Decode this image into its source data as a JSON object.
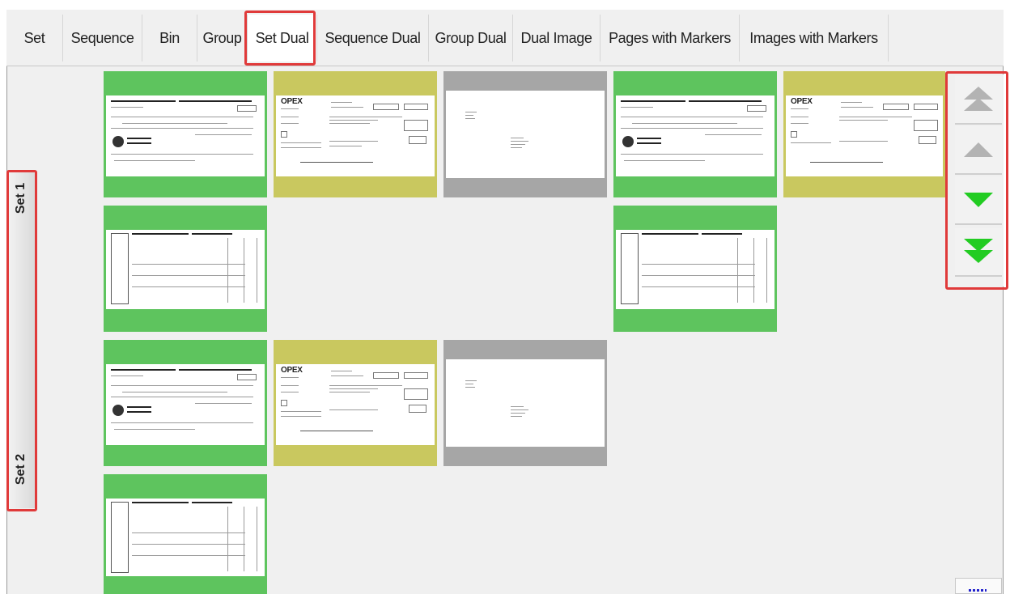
{
  "tabs": [
    {
      "label": "Set"
    },
    {
      "label": "Sequence"
    },
    {
      "label": "Bin"
    },
    {
      "label": "Group"
    },
    {
      "label": "Set Dual"
    },
    {
      "label": "Sequence Dual"
    },
    {
      "label": "Group Dual"
    },
    {
      "label": "Dual Image"
    },
    {
      "label": "Pages with Markers"
    },
    {
      "label": "Images with Markers"
    }
  ],
  "active_tab": "Set Dual",
  "set_tabs": [
    {
      "label": "Set 1"
    },
    {
      "label": "Set 2"
    }
  ],
  "doc_logo": "OPEX",
  "colors": {
    "check_frame": "#5ec45e",
    "form_frame": "#c9c85f",
    "envelope_frame": "#a6a6a6",
    "highlight": "#e03a3a",
    "nav_up": "#b3b3b3",
    "nav_down": "#22cc22"
  },
  "nav_buttons": [
    {
      "icon": "double-chevron-up-icon"
    },
    {
      "icon": "chevron-up-icon"
    },
    {
      "icon": "chevron-down-icon"
    },
    {
      "icon": "double-chevron-down-icon"
    }
  ],
  "menu_icon": "more-icon"
}
